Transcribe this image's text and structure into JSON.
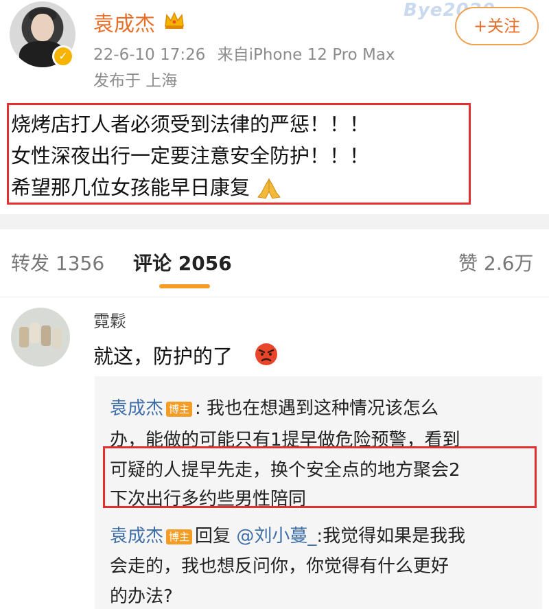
{
  "header": {
    "username": "袁成杰",
    "timestamp": "22-6-10 17:26",
    "source": "来自iPhone 12 Pro Max",
    "location": "发布于 上海",
    "follow_label": "+关注",
    "watermark": "Bye2020",
    "verified_glyph": "✓"
  },
  "post": {
    "lines": [
      "烧烤店打人者必须受到法律的严惩！！！",
      "女性深夜出行一定要注意安全防护！！！",
      "希望那几位女孩能早日康复"
    ],
    "emoji": "pray-icon"
  },
  "tabs": {
    "repost": "转发 1356",
    "comments": "评论 2056",
    "likes": "赞 2.6万"
  },
  "comment": {
    "author": "霓鬏",
    "text": "就这，防护的了",
    "emoji": "angry-face-icon",
    "replies": [
      {
        "author": "袁成杰",
        "badge": "博主",
        "lines": [
          ": 我也在想遇到这种情况该怎么",
          "办，能做的可能只有1提早做危险预警，看到",
          "可疑的人提早先走，换个安全点的地方聚会2",
          "下次出行多约些男性陪同"
        ]
      },
      {
        "author": "袁成杰",
        "badge": "博主",
        "reply_word": "回复",
        "mention": "@刘小蔓_",
        "lines": [
          ":我觉得如果是我我",
          "会走的，我也想反问你，你觉得有什么更好",
          "的办法?"
        ]
      }
    ]
  },
  "colors": {
    "accent": "#e8702a",
    "highlight_border": "#e03030",
    "link": "#3d6ea8",
    "tab_underline": "#f39c26"
  }
}
